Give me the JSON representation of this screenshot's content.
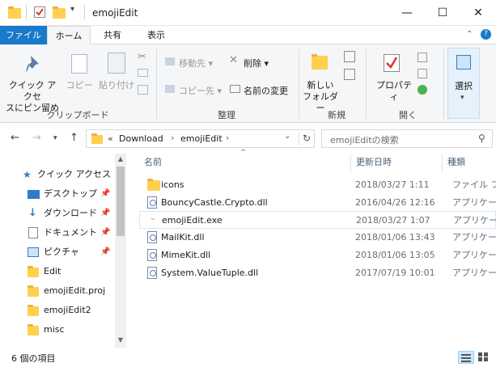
{
  "window": {
    "title": "emojiEdit",
    "minimize": "—",
    "maximize": "☐",
    "close": "✕"
  },
  "tabs": [
    {
      "label": "ファイル"
    },
    {
      "label": "ホーム"
    },
    {
      "label": "共有"
    },
    {
      "label": "表示"
    }
  ],
  "ribbon": {
    "pin_quick": "クイック アクセ\nスにピン留め",
    "copy": "コピー",
    "paste": "貼り付け",
    "group_clipboard": "クリップボード",
    "move_to": "移動先",
    "copy_to": "コピー先",
    "delete": "削除",
    "rename": "名前の変更",
    "group_organize": "整理",
    "new_folder": "新しい\nフォルダー",
    "group_new": "新規",
    "properties": "プロパティ",
    "group_open": "開く",
    "select": "選択"
  },
  "address": {
    "prefix": "«",
    "crumbs": [
      "Download",
      "emojiEdit"
    ],
    "search_placeholder": "emojiEditの検索"
  },
  "nav": {
    "quick_access": "クイック アクセス",
    "items": [
      {
        "label": "デスクトップ",
        "pinned": true
      },
      {
        "label": "ダウンロード",
        "pinned": true
      },
      {
        "label": "ドキュメント",
        "pinned": true
      },
      {
        "label": "ピクチャ",
        "pinned": true
      },
      {
        "label": "Edit",
        "pinned": false
      },
      {
        "label": "emojiEdit.proj",
        "pinned": false
      },
      {
        "label": "emojiEdit2",
        "pinned": false
      },
      {
        "label": "misc",
        "pinned": false
      }
    ]
  },
  "columns": {
    "name": "名前",
    "date": "更新日時",
    "type": "種類"
  },
  "files": [
    {
      "name": "icons",
      "date": "2018/03/27 1:11",
      "type": "ファイル フォ",
      "kind": "folder"
    },
    {
      "name": "BouncyCastle.Crypto.dll",
      "date": "2016/04/26 12:16",
      "type": "アプリケーシ",
      "kind": "dll"
    },
    {
      "name": "emojiEdit.exe",
      "date": "2018/03/27 1:07",
      "type": "アプリケーシ",
      "kind": "exe"
    },
    {
      "name": "MailKit.dll",
      "date": "2018/01/06 13:43",
      "type": "アプリケーシ",
      "kind": "dll"
    },
    {
      "name": "MimeKit.dll",
      "date": "2018/01/06 13:05",
      "type": "アプリケーシ",
      "kind": "dll"
    },
    {
      "name": "System.ValueTuple.dll",
      "date": "2017/07/19 10:01",
      "type": "アプリケーシ",
      "kind": "dll"
    }
  ],
  "status": {
    "item_count": "6 個の項目"
  },
  "colors": {
    "file_tab": "#1979ca",
    "folder": "#ffd04e",
    "selection_border": "#cde8ff"
  }
}
